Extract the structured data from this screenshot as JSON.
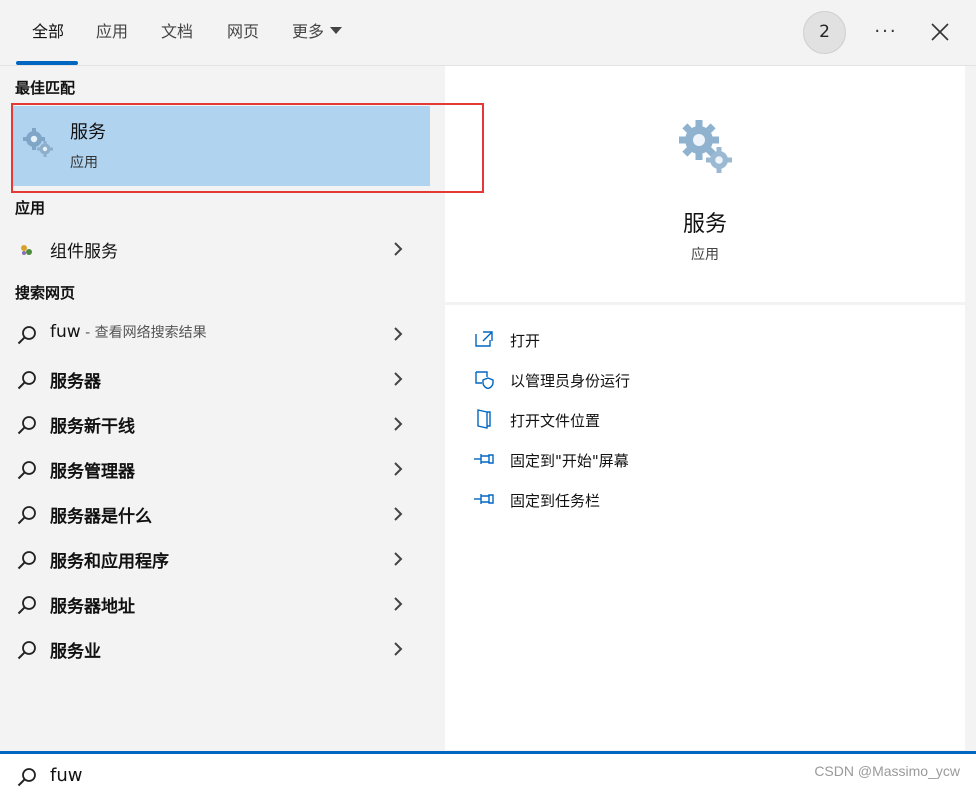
{
  "tabs": [
    {
      "label": "全部"
    },
    {
      "label": "应用"
    },
    {
      "label": "文档"
    },
    {
      "label": "网页"
    },
    {
      "label": "更多"
    }
  ],
  "badge_count": "2",
  "more_options": "···",
  "sections": {
    "best_match": "最佳匹配",
    "apps": "应用",
    "web": "搜索网页"
  },
  "best_match": {
    "title": "服务",
    "subtitle": "应用",
    "icon": "gears-icon"
  },
  "apps": [
    {
      "label": "组件服务",
      "icon": "component-services-icon"
    }
  ],
  "web_results": [
    {
      "label": "fuw",
      "hint": " - 查看网络搜索结果"
    },
    {
      "label": "服务器"
    },
    {
      "label": "服务新干线"
    },
    {
      "label": "服务管理器"
    },
    {
      "label": "服务器是什么"
    },
    {
      "label": "服务和应用程序"
    },
    {
      "label": "服务器地址"
    },
    {
      "label": "服务业"
    }
  ],
  "detail": {
    "title": "服务",
    "subtitle": "应用",
    "actions": [
      {
        "label": "打开",
        "icon": "open-icon"
      },
      {
        "label": "以管理员身份运行",
        "icon": "shield-icon"
      },
      {
        "label": "打开文件位置",
        "icon": "folder-location-icon"
      },
      {
        "label": "固定到\"开始\"屏幕",
        "icon": "pin-icon"
      },
      {
        "label": "固定到任务栏",
        "icon": "pin-icon"
      }
    ]
  },
  "search": {
    "value": "fuw"
  },
  "watermark": "CSDN @Massimo_ycw",
  "colors": {
    "accent": "#0067c0",
    "selection": "#b0d3ef",
    "highlight_box": "#e53935"
  }
}
